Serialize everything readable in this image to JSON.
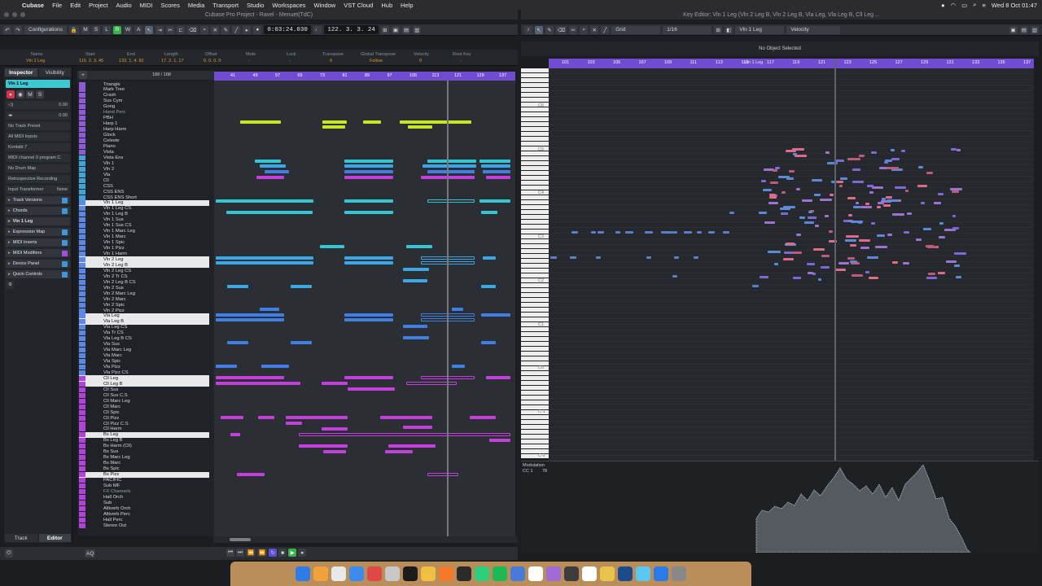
{
  "menubar": {
    "app": "Cubase",
    "items": [
      "File",
      "Edit",
      "Project",
      "Audio",
      "MIDI",
      "Scores",
      "Media",
      "Transport",
      "Studio",
      "Workspaces",
      "Window",
      "VST Cloud",
      "Hub",
      "Help"
    ],
    "clock": "Wed 8 Oct 01:47"
  },
  "project_window": {
    "title": "Cubase Pro Project - Ravel - Menuet(TdC)",
    "configurations": "Configurations",
    "time_display": "0:03:24.030",
    "bars_display": "122. 3. 3. 24",
    "info_line": {
      "headers": [
        "Name",
        "Start",
        "End",
        "Length",
        "Offset",
        "Mute",
        "Lock",
        "Transpose",
        "Global Transpose",
        "Velocity",
        "Root Key"
      ],
      "values": [
        "Vln 1 Leg",
        "115. 2. 3. 45",
        "133. 1. 4. 82",
        "17. 2. 1. 17",
        "0. 0. 0. 0",
        "-",
        "-",
        "0",
        "Follow",
        "0",
        "-"
      ]
    },
    "track_count": "188 / 188",
    "ruler_ticks": [
      "41",
      "49",
      "57",
      "65",
      "73",
      "81",
      "89",
      "97",
      "105",
      "113",
      "121",
      "129",
      "137"
    ]
  },
  "inspector": {
    "tabs": [
      "Inspector",
      "Visibility"
    ],
    "track_name": "Vln 1 Leg",
    "volume": "0.00",
    "pan": "0.00",
    "preset": "No Track Preset",
    "input": "All MIDI Inputs",
    "output": "Kontakt 7",
    "program": "MIDI channel 0 program C",
    "drum_map": "No Drum Map",
    "retro": "Retrospective Recording",
    "input_transformer_label": "Input Transformer",
    "input_transformer_value": "None",
    "sections": [
      "Track Versions",
      "Chords",
      "Vln 1 Leg",
      "Expression Map",
      "MIDI Inserts",
      "MIDI Modifiers",
      "Device Panel",
      "Quick Controls"
    ],
    "bottom_tabs": [
      "Track",
      "Editor"
    ]
  },
  "tracks": [
    "Triangle",
    "Mark Tree",
    "Crash",
    "Sus Cym",
    "Gong",
    "Hand Perc",
    "PBH",
    "Harp 1",
    "Harp Harm",
    "Glock",
    "Celeste",
    "Piano",
    "Vista",
    "Vista Ens",
    "Vln 1",
    "Vln 2",
    "Vla",
    "Cll",
    "CSS",
    "CSS ENS",
    "CSS ENS Short",
    "Vln 1 Leg",
    "Vln 1 Leg CS",
    "Vln 1 Leg B",
    "Vln 1 Sus",
    "Vln 1 Sus CS",
    "Vln 1 Marc Leg",
    "Vln 1 Marc",
    "Vln 1 Spic",
    "Vln 1 Pizz",
    "Vln 1 Harm",
    "Vln 2 Leg",
    "Vln 2 Leg B",
    "Vln 2 Leg CS",
    "Vln 2 Tr CS",
    "Vln 2 Leg B CS",
    "Vln 2 Sus",
    "Vln 2 Marc Leg",
    "Vln 2 Marc",
    "Vln 2 Spic",
    "Vln 2 Pizz",
    "Vla Leg",
    "Vla Leg B",
    "Vla Leg CS",
    "Vla Tr CS",
    "Vla Leg B CS",
    "Vla Sus",
    "Vla Marc Leg",
    "Vla Marc",
    "Vla Spic",
    "Vla Pizz",
    "Vla Pizz CS",
    "Cll Leg",
    "Cll Leg B",
    "Cll Sus",
    "Cll Sus C.S",
    "Cll Marc Leg",
    "Cll Marc",
    "Cll Spic",
    "Cll Pizz",
    "Cll Pizz C.S",
    "Cll Harm",
    "Bs Leg",
    "Bs Leg B",
    "Bs Harm (Cll)",
    "Bs Sus",
    "Bs Marc Leg",
    "Bs Marc",
    "Bs Spic",
    "Bs Pizz",
    "PACIFIC",
    "Sub MF",
    "FX Channels",
    "Hall Orch",
    "Sub",
    "Altiverb Orch",
    "Altiverb Perc",
    "Hall Perc",
    "Stereo Out"
  ],
  "key_editor": {
    "title": "Key Editor: Vln 1 Leg (Vln 2 Leg B, Vln 2 Leg B, Vla Leg, Vla Leg B, Cll Leg ...",
    "grid": "Grid",
    "quantize": "1/16",
    "track": "Vln 1 Leg",
    "controller": "Velocity",
    "status": "No Object Selected",
    "ruler_ticks": [
      "101",
      "103",
      "105",
      "107",
      "109",
      "111",
      "113",
      "115",
      "117",
      "119",
      "121",
      "123",
      "125",
      "127",
      "129",
      "131",
      "133",
      "135",
      "137"
    ],
    "marker": "Vln 1 Leg",
    "octaves": [
      "C6",
      "C5",
      "C4",
      "C3",
      "C2",
      "C1",
      "C0",
      "C-1",
      "C-2"
    ],
    "controller_lane": "Modulation",
    "controller_sub": "CC 1",
    "controller_value": "78"
  },
  "colors": {
    "ruler": "#6f4cd1",
    "harp": "#c8e628",
    "vln1": "#34c6d6",
    "vln2": "#3aa8e6",
    "vla": "#3f7fe6",
    "cll": "#c43ee0"
  }
}
